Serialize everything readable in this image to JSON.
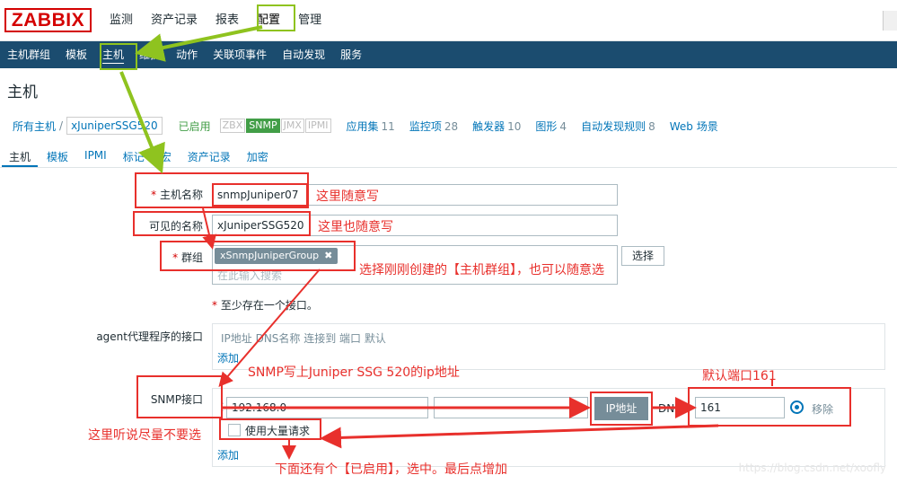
{
  "app": {
    "logo": "ZABBIX"
  },
  "topnav": [
    "监测",
    "资产记录",
    "报表",
    "配置",
    "管理"
  ],
  "subnav": [
    "主机群组",
    "模板",
    "主机",
    "维护",
    "动作",
    "关联项事件",
    "自动发现",
    "服务"
  ],
  "page_title": "主机",
  "host_bar": {
    "all_hosts": "所有主机",
    "separator": "/",
    "host_name": "xJuniperSSG520",
    "status": "已启用",
    "availability": [
      "ZBX",
      "SNMP",
      "JMX",
      "IPMI"
    ],
    "links": [
      {
        "label": "应用集",
        "count": "11"
      },
      {
        "label": "监控项",
        "count": "28"
      },
      {
        "label": "触发器",
        "count": "10"
      },
      {
        "label": "图形",
        "count": "4"
      },
      {
        "label": "自动发现规则",
        "count": "8"
      },
      {
        "label": "Web 场景",
        "count": ""
      }
    ]
  },
  "tabs": [
    "主机",
    "模板",
    "IPMI",
    "标记",
    "宏",
    "资产记录",
    "加密"
  ],
  "form": {
    "hostname_label": "主机名称",
    "hostname_value": "snmpJuniper07",
    "visible_label": "可见的名称",
    "visible_value": "xJuniperSSG520",
    "groups_label": "群组",
    "group_tag": "xSnmpJuniperGroup",
    "group_tag_remove": "✖",
    "group_placeholder": "在此输入搜索",
    "select_button": "选择",
    "required_note": "至少存在一个接口。",
    "agent_label": "agent代理程序的接口",
    "iface_headers": "IP地址  DNS名称  连接到  端口  默认",
    "add_link": "添加",
    "snmp_label": "SNMP接口",
    "snmp_ip": "192.168.0",
    "connect_ip_button": "IP地址",
    "connect_dns": "DNS",
    "snmp_port": "161",
    "remove_link": "移除",
    "bulk_label": "使用大量请求",
    "add_link_2": "添加"
  },
  "annotations": {
    "a1": "这里随意写",
    "a2": "这里也随意写",
    "a3": "选择刚刚创建的【主机群组】，也可以随意选",
    "a4": "SNMP写上Juniper SSG 520的ip地址",
    "a5": "默认端口161",
    "a6": "这里听说尽量不要选",
    "a7": "下面还有个【已启用】，选中。最后点增加"
  },
  "watermark": "https://blog.csdn.net/xoofly",
  "colors": {
    "header_bg": "#1b4c6f",
    "annotation_red": "#e8302c",
    "annotation_green": "#8fc31f",
    "enabled_green": "#429e47",
    "link_blue": "#0275b8"
  }
}
